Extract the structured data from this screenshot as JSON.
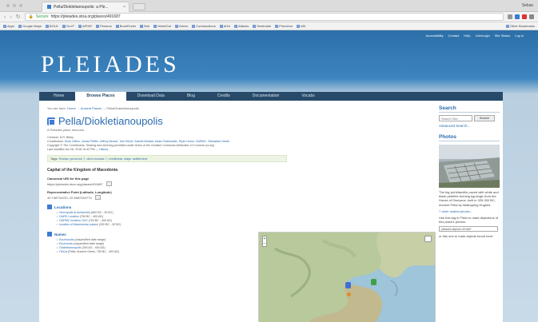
{
  "browser": {
    "tab_title": "Pella/Diokletianoupolis: a Ple...",
    "user_label": "Sebas",
    "url_secure_label": "Secure",
    "url": "https://pleiades.stoa.org/places/491687",
    "bookmarks": [
      "Apps",
      "Google Maps",
      "BOLD",
      "Go.IP",
      "AFDIR",
      "Perseus",
      "BookFinder",
      "Bnk",
      "WorldCat",
      "Zotero",
      "Constructions",
      "AHA",
      "Attacks",
      "Seminaire",
      "Princeton",
      "AM"
    ],
    "other_bookmarks": "Other Bookmarks"
  },
  "site": {
    "logo": "PLEIADES",
    "top_links": [
      "Accessibility",
      "Contact",
      "Help",
      "Join/Login",
      "Site Status"
    ],
    "top_link_extra": "Log in",
    "nav": [
      "Home",
      "Browse Places",
      "Download Data",
      "Blog",
      "Credits",
      "Documentation",
      "Vocabs"
    ]
  },
  "place": {
    "breadcrumb": {
      "prefix": "You are here:",
      "home": "Home",
      "sep": "→",
      "ancient_places": "Ancient Places",
      "current": "Pella/Diokletianoupolis"
    },
    "title": "Pella/Diokletianoupolis",
    "subtitle": "A Pleiades place resource",
    "meta": {
      "creators": "Creators: D.R. Birley",
      "contributors_label": "Contributors:",
      "contributors": "Sean Gillies, Jonas Pfeffer, Jeffrey Becker, Tom Elliott, Gabriel Bodard, Adam Rabinowitz, Ryan Horne, DARMC, Sebastian Heath",
      "copyright": "Copyright © The Contributors. Sharing and remixing permitted under terms of the Creative Commons Attribution 3.0 License (cc-by).",
      "modified": "Last modified Jun 28, 2018 10:42 PM",
      "history": "History"
    },
    "tags": {
      "label": "Tags:",
      "values": "Roman province ?, cited mosaic ?, rectilinear major settlement"
    },
    "description": "Capital of the Kingdom of Macedonia",
    "canonical_label": "Canonical URI for this page",
    "canonical_value": "https://pleiades.stoa.org/places/491687",
    "repr_label": "Representative Point (Latitude, Longitude)",
    "repr_value": "40.748734133, 22.5987334773",
    "locations": {
      "heading": "Locations",
      "items": [
        {
          "link": "Necropolis at Acharnella",
          "rest": "(800 BC - 30 BC)"
        },
        {
          "link": "DARE Location",
          "rest": "(750 BC - 400 AD)"
        },
        {
          "link": "DARMC location 2110",
          "rest": "(750 BC - 400 AD)"
        },
        {
          "link": "location of Macedonian palace",
          "rest": "(330 BC - 30 BC)"
        }
      ]
    },
    "names": {
      "heading": "Names",
      "items": [
        {
          "link": "Boumounia",
          "rest": "(unspecified date range)"
        },
        {
          "link": "Boumonia",
          "rest": "(unspecified date range)"
        },
        {
          "link": "Diokletianoupolis",
          "rest": "(300 AD - 400 AD)"
        },
        {
          "link": "Πέλλα",
          "rest": "(Pella; Ancient Greek, 750 BC - 400 AD)"
        }
      ]
    }
  },
  "map": {
    "zoom_in": "+",
    "zoom_out": "−"
  },
  "sidebar": {
    "search_title": "Search",
    "search_placeholder": "Search Site",
    "search_button": "Search",
    "advanced": "Advanced Search...",
    "photos_title": "Photos",
    "caption": "The big sicht/tamiilie paved with white and black pebbles forming typologic from the House of Dionysos, built in 325-300 BC, Ancient Pella by Wallopping Hughes.",
    "more_photos": "7 other related photos...",
    "tag_hint": "Use this tag in Flickr to mark depictions of this place's photos:",
    "short_url": "pleiades:depicts=491687",
    "also_hint": "or this one to mark objects found here:"
  },
  "colors": {
    "brand_blue": "#2c6fa8",
    "nav_dark": "#274a6a",
    "link": "#2a6bb0"
  }
}
